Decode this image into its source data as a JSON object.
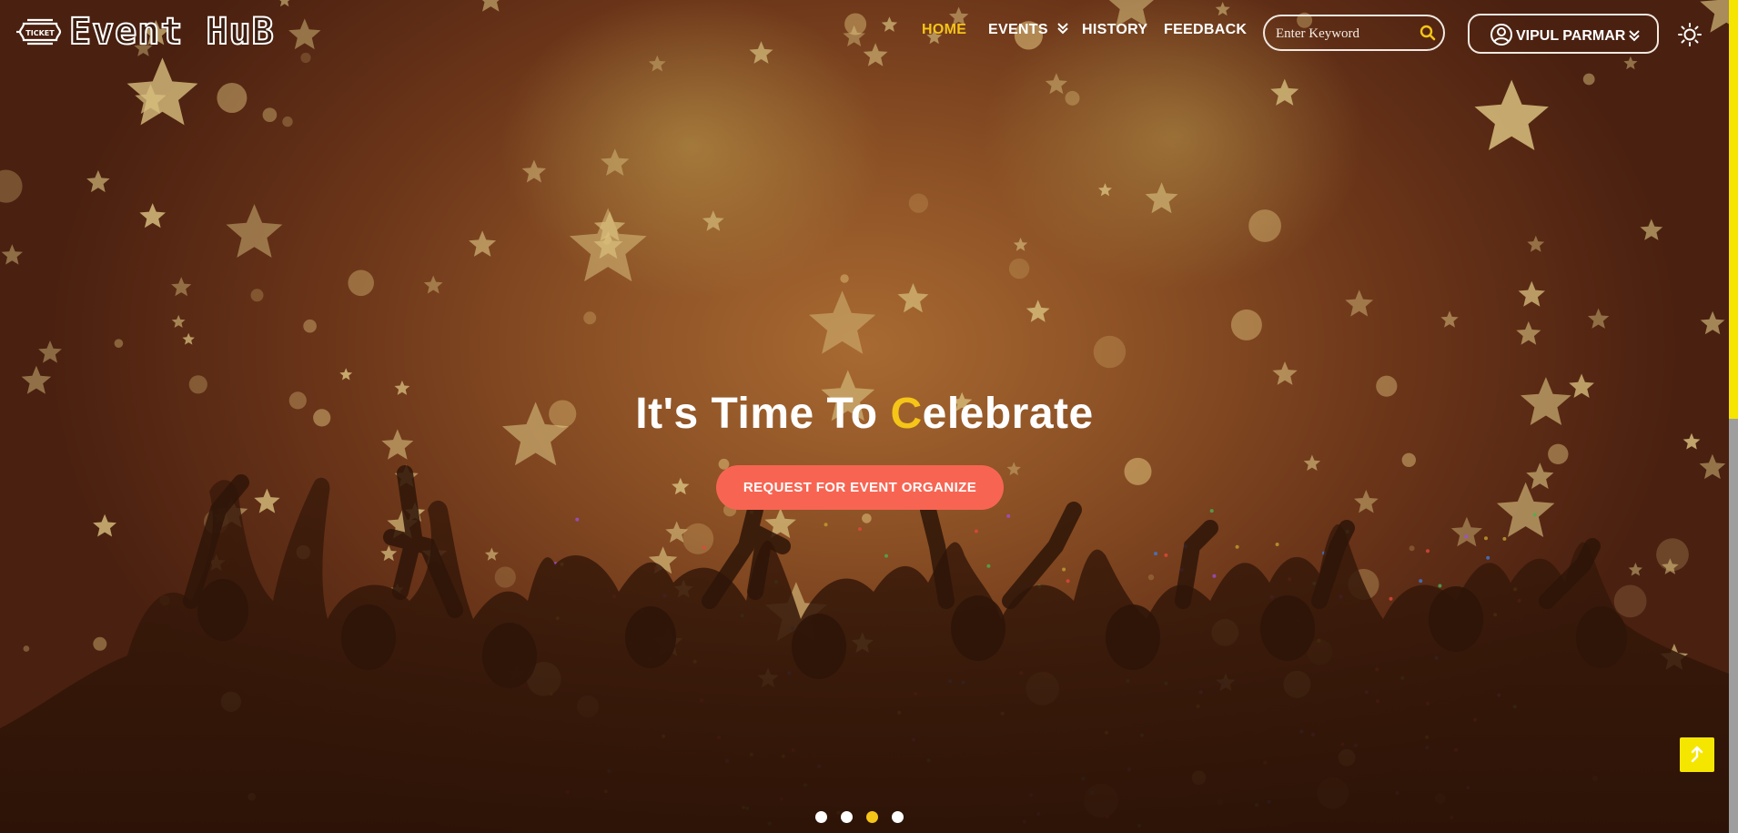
{
  "brand": {
    "logo_text": "Event HuB",
    "badge_text": "TICKET"
  },
  "nav": {
    "items": [
      {
        "label": "HOME",
        "active": true
      },
      {
        "label": "EVENTS",
        "has_dropdown": true
      },
      {
        "label": "HISTORY"
      },
      {
        "label": "FEEDBACK"
      }
    ]
  },
  "search": {
    "placeholder": "Enter Keyword",
    "value": "",
    "icon": "search-icon"
  },
  "user": {
    "name": "VIPUL PARMAR",
    "icon": "user-circle-icon"
  },
  "theme_toggle": {
    "icon": "sun-icon"
  },
  "hero": {
    "title_before": "It's Time To ",
    "title_accent": "C",
    "title_after": "elebrate",
    "cta_label": "REQUEST FOR EVENT ORGANIZE"
  },
  "carousel": {
    "slide_count": 4,
    "active_index": 2
  },
  "back_to_top": {
    "icon": "arrow-up-icon"
  },
  "colors": {
    "accent": "#f5c518",
    "cta": "#f76552",
    "scroll_thumb": "#f5e500",
    "background": "#8a4f24"
  }
}
